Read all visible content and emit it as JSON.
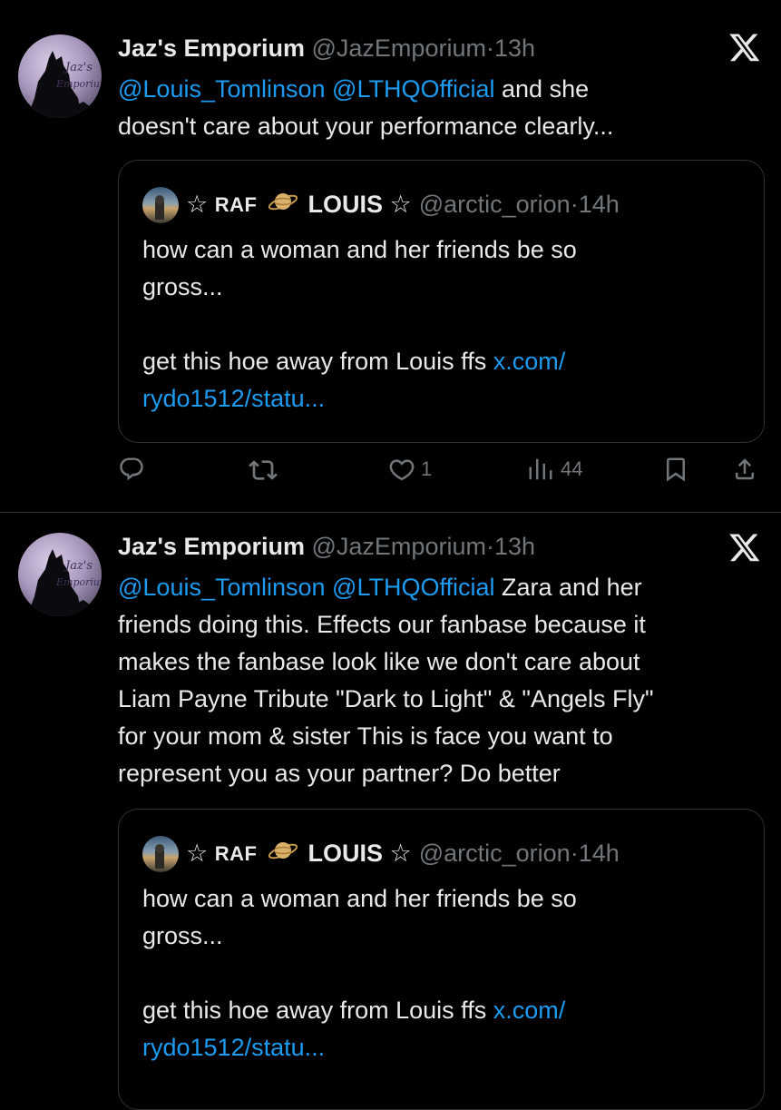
{
  "tweets": [
    {
      "author_name": "Jaz's Emporium",
      "author_handle": "@JazEmporium",
      "separator": "·",
      "time": "13h",
      "avatar_text": "Jaz's Emporium",
      "mention1": "@Louis_Tomlinson",
      "mention2": "@LTHQOfficial",
      "text_line1_rest": "and she",
      "text_rest": "doesn't care about your performance clearly...",
      "quote": {
        "star_left": "☆",
        "raf": "RAF",
        "name": "LOUIS",
        "star_right": "☆",
        "handle": "@arctic_orion",
        "separator": "·",
        "time": "14h",
        "line1": "how can a woman and her friends be so",
        "line2": "gross...",
        "line3": "get this hoe away from Louis ffs",
        "link1": "x.com/",
        "link2": "rydo1512/statu..."
      },
      "likes": "1",
      "views": "44"
    },
    {
      "author_name": "Jaz's Emporium",
      "author_handle": "@JazEmporium",
      "separator": "·",
      "time": "13h",
      "avatar_text": "Jaz's Emporium",
      "mention1": "@Louis_Tomlinson",
      "mention2": "@LTHQOfficial",
      "text_line1_rest": "Zara and her",
      "lines": [
        "friends doing this. Effects our fanbase because it",
        "makes the fanbase look like we don't care about",
        "Liam Payne Tribute \"Dark to Light\" & \"Angels Fly\"",
        "for your mom & sister This is face you want to",
        "represent you as your partner? Do better"
      ],
      "quote": {
        "star_left": "☆",
        "raf": "RAF",
        "name": "LOUIS",
        "star_right": "☆",
        "handle": "@arctic_orion",
        "separator": "·",
        "time": "14h",
        "line1": "how can a woman and her friends be so",
        "line2": "gross...",
        "line3": "get this hoe away from Louis ffs",
        "link1": "x.com/",
        "link2": "rydo1512/statu..."
      }
    }
  ],
  "icons": {
    "reply": "reply-icon",
    "repost": "repost-icon",
    "like": "like-icon",
    "views": "views-icon",
    "bookmark": "bookmark-icon",
    "share": "share-icon",
    "x_logo": "x-logo-icon",
    "saturn": "saturn-icon"
  },
  "colors": {
    "background": "#000000",
    "text": "#e7e9ea",
    "muted": "#71767b",
    "link": "#1d9bf0",
    "border": "#2f3336"
  }
}
